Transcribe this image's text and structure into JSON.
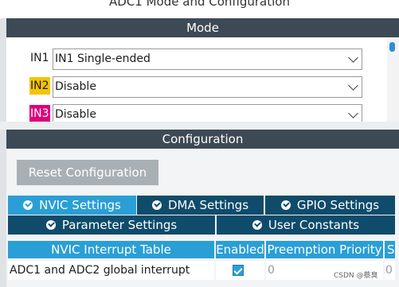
{
  "window": {
    "title": "ADC1 Mode and Configuration"
  },
  "mode": {
    "header": "Mode",
    "inputs": [
      {
        "label": "IN1",
        "value": "IN1 Single-ended"
      },
      {
        "label": "IN2",
        "value": "Disable",
        "highlight": "#f5c400"
      },
      {
        "label": "IN3",
        "value": "Disable",
        "highlight": "#e0007a"
      }
    ]
  },
  "configuration": {
    "header": "Configuration",
    "reset_label": "Reset Configuration",
    "tabs": [
      {
        "label": "NVIC Settings",
        "active": true
      },
      {
        "label": "DMA Settings",
        "active": false
      },
      {
        "label": "GPIO Settings",
        "active": false
      },
      {
        "label": "Parameter Settings",
        "active": false
      },
      {
        "label": "User Constants",
        "active": false
      }
    ],
    "table": {
      "columns": [
        "NVIC Interrupt Table",
        "Enabled",
        "Preemption Priority",
        "S"
      ],
      "rows": [
        {
          "name": "ADC1 and ADC2 global interrupt",
          "enabled": true,
          "preemption": "0",
          "sub": "0"
        }
      ]
    }
  },
  "colors": {
    "header": "#3d4a55",
    "tab_active": "#2a9fd6",
    "tab_inactive": "#0f4c6b"
  },
  "watermark": "CSDN @蔡臭"
}
